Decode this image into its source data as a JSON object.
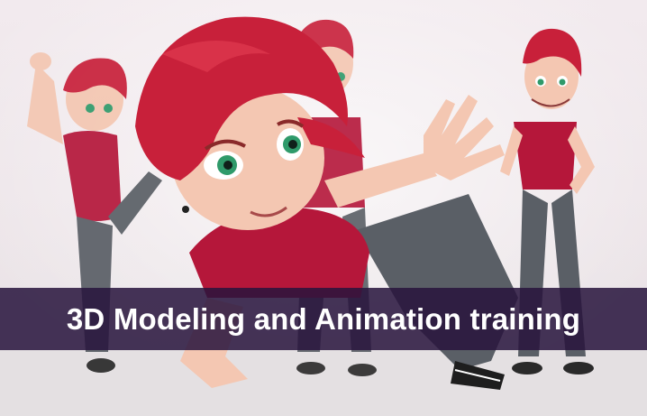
{
  "banner": {
    "title": "3D Modeling and Animation training"
  },
  "colors": {
    "hair": "#c8203a",
    "shirt": "#b5173a",
    "jeans": "#5a5f66",
    "skin": "#f4c7b2",
    "eyes": "#2f9a6a",
    "banner": "#28143c"
  }
}
